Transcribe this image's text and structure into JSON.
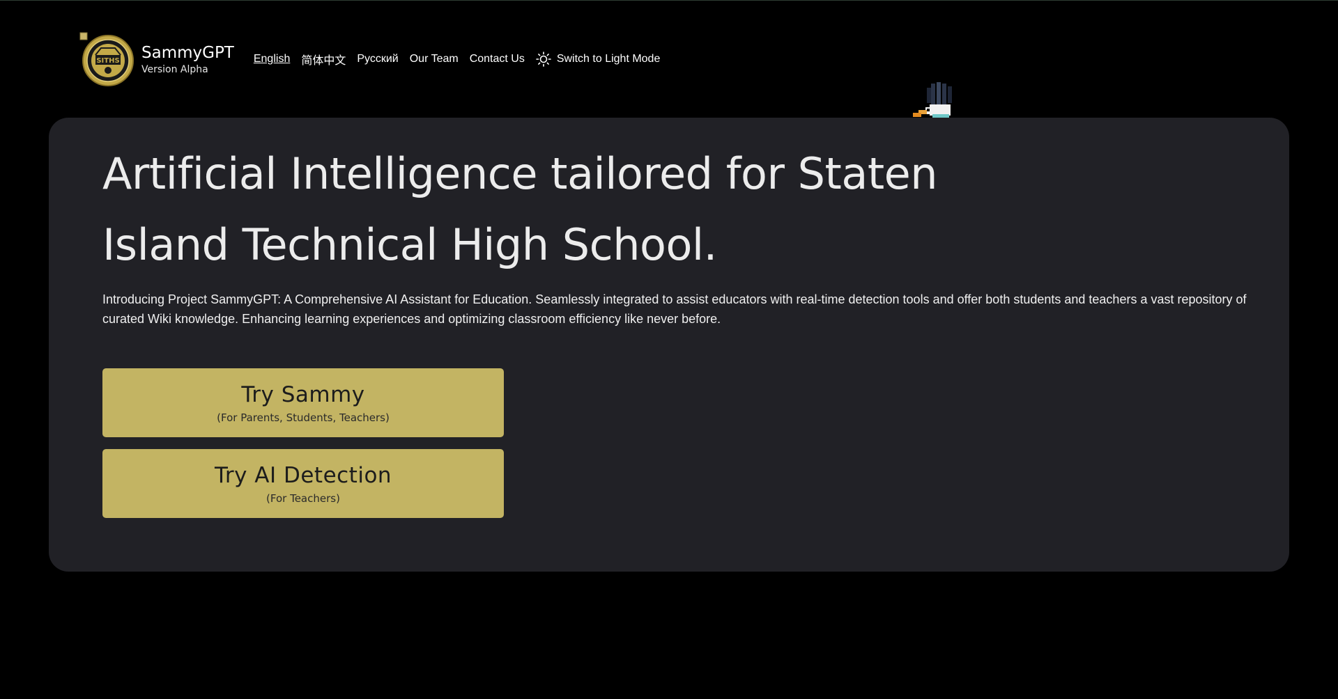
{
  "header": {
    "brand_name": "SammyGPT",
    "version": "Version Alpha",
    "logo_icon": "siths-seal-logo",
    "nav": [
      {
        "label": "English",
        "active": true
      },
      {
        "label": "简体中文",
        "active": false
      },
      {
        "label": "Русский",
        "active": false
      },
      {
        "label": "Our Team",
        "active": false
      },
      {
        "label": "Contact Us",
        "active": false
      }
    ],
    "theme_toggle": {
      "icon": "sun-icon",
      "label": "Switch to Light Mode"
    }
  },
  "hero": {
    "title": "Artificial Intelligence tailored for Staten Island Technical High School.",
    "description": "Introducing Project SammyGPT: A Comprehensive AI Assistant for Education. Seamlessly integrated to assist educators with real-time detection tools and offer both students and teachers a vast repository of curated Wiki knowledge. Enhancing learning experiences and optimizing classroom efficiency like never before.",
    "buttons": [
      {
        "title": "Try Sammy",
        "subtitle": "(For Parents, Students, Teachers)"
      },
      {
        "title": "Try AI Detection",
        "subtitle": "(For Teachers)"
      }
    ]
  },
  "colors": {
    "background": "#000000",
    "card": "#212126",
    "accent": "#c3b463",
    "text": "#ececec"
  }
}
